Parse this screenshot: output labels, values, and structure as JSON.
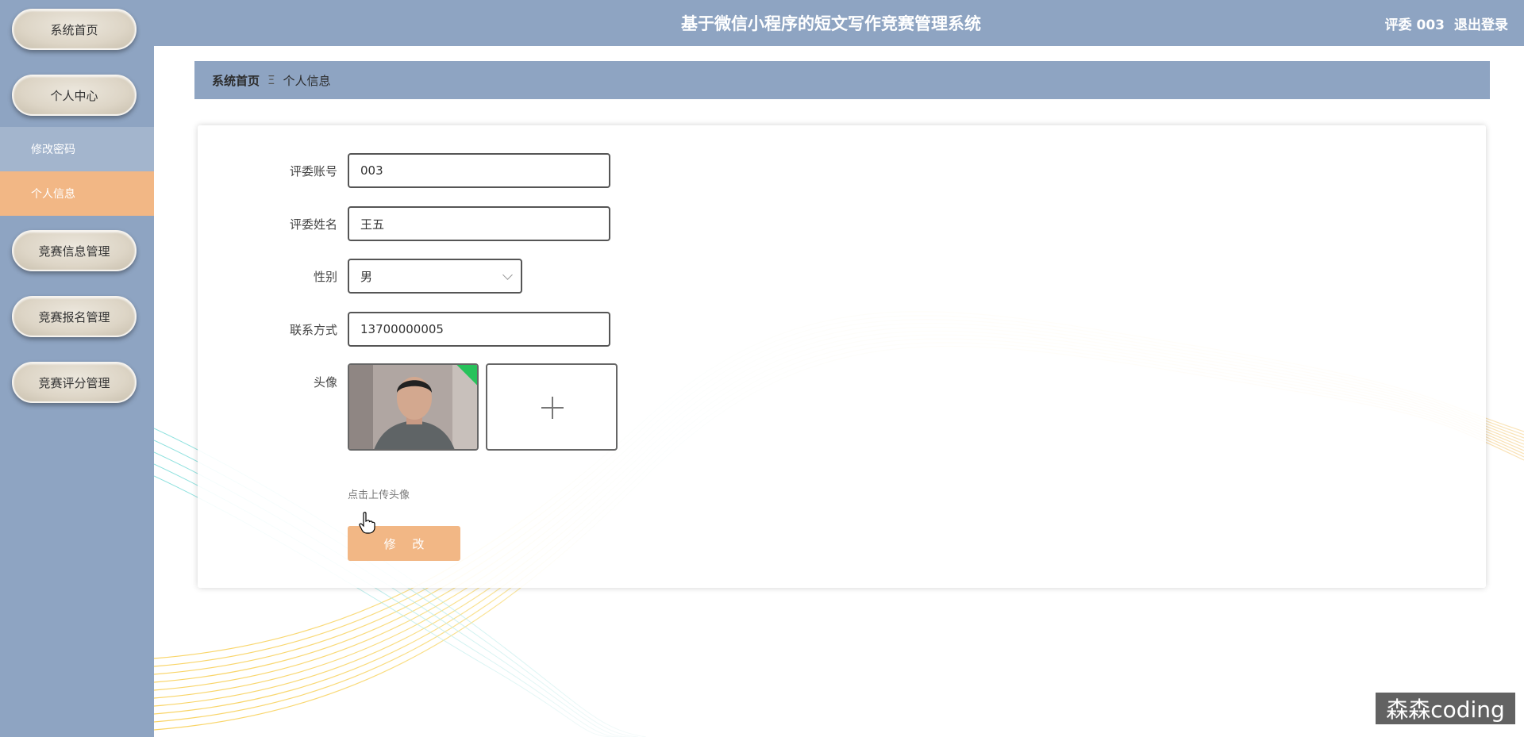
{
  "app": {
    "title": "基于微信小程序的短文写作竞赛管理系统",
    "user_label": "评委 003",
    "logout_label": "退出登录"
  },
  "sidebar": {
    "items": [
      {
        "label": "系统首页"
      },
      {
        "label": "个人中心"
      },
      {
        "label": "竞赛信息管理"
      },
      {
        "label": "竞赛报名管理"
      },
      {
        "label": "竞赛评分管理"
      }
    ],
    "submenu": [
      {
        "label": "修改密码"
      },
      {
        "label": "个人信息"
      }
    ]
  },
  "breadcrumb": {
    "home": "系统首页",
    "separator": "Ξ",
    "current": "个人信息"
  },
  "form": {
    "account": {
      "label": "评委账号",
      "value": "003"
    },
    "name": {
      "label": "评委姓名",
      "value": "王五"
    },
    "gender": {
      "label": "性别",
      "value": "男"
    },
    "contact": {
      "label": "联系方式",
      "value": "13700000005"
    },
    "avatar": {
      "label": "头像",
      "hint": "点击上传头像"
    },
    "submit_label": "修 改"
  },
  "watermark": "森森coding",
  "colors": {
    "sidebar_bg": "#8ea4c2",
    "accent": "#f2b785",
    "submenu_bg": "#a3b5cd"
  }
}
